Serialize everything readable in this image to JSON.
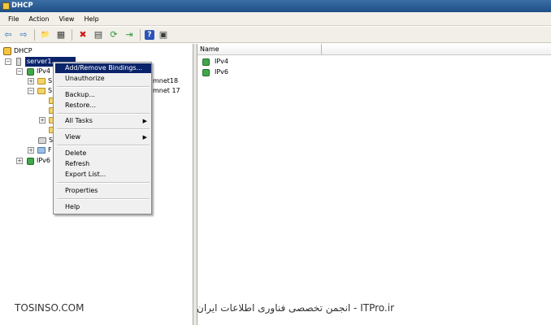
{
  "window": {
    "title": "DHCP"
  },
  "menubar": {
    "items": [
      "File",
      "Action",
      "View",
      "Help"
    ]
  },
  "toolbar": {
    "buttons": [
      {
        "name": "back-icon",
        "glyph": "⇦"
      },
      {
        "name": "forward-icon",
        "glyph": "⇨"
      },
      {
        "name": "up-folder-icon",
        "glyph": "📁"
      },
      {
        "name": "show-hide-tree-icon",
        "glyph": "▦"
      },
      {
        "name": "delete-icon",
        "glyph": "✖"
      },
      {
        "name": "properties-icon",
        "glyph": "▤"
      },
      {
        "name": "refresh-icon",
        "glyph": "⟳"
      },
      {
        "name": "export-list-icon",
        "glyph": "⇥"
      },
      {
        "name": "help-icon",
        "glyph": "?"
      },
      {
        "name": "console-tree-icon",
        "glyph": "▣"
      }
    ]
  },
  "tree": {
    "root": "DHCP",
    "server": "server1.",
    "ipv4": "IPv4",
    "ipv6": "IPv6",
    "scope_fragment_1": "mnet18",
    "scope_fragment_2": "mnet 17",
    "s1": "S",
    "s2": "S",
    "s3": "S",
    "f1": "F"
  },
  "list": {
    "columns": [
      "Name"
    ],
    "items": [
      "IPv4",
      "IPv6"
    ]
  },
  "context_menu": {
    "items": [
      {
        "label": "Add/Remove Bindings...",
        "active": true
      },
      {
        "label": "Unauthorize"
      },
      {
        "separator": true
      },
      {
        "label": "Backup..."
      },
      {
        "label": "Restore..."
      },
      {
        "separator": true
      },
      {
        "label": "All Tasks",
        "submenu": true
      },
      {
        "separator": true
      },
      {
        "label": "View",
        "submenu": true
      },
      {
        "separator": true
      },
      {
        "label": "Delete"
      },
      {
        "label": "Refresh"
      },
      {
        "label": "Export List..."
      },
      {
        "separator": true
      },
      {
        "label": "Properties"
      },
      {
        "separator": true
      },
      {
        "label": "Help"
      }
    ]
  },
  "watermarks": {
    "left": "TOSINSO.COM",
    "right": "ITPro.ir - انجمن تخصصی فناوری اطلاعات ایران"
  },
  "colors": {
    "title_bar": "#1f4f86",
    "selection": "#0a246a",
    "menu_bg": "#f0f0f0"
  }
}
